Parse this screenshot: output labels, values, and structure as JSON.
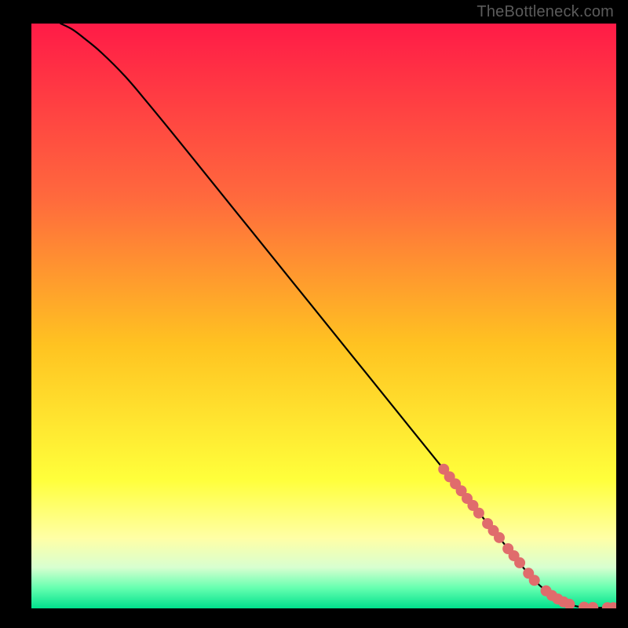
{
  "watermark": "TheBottleneck.com",
  "colors": {
    "frame": "#000000",
    "curve": "#000000",
    "marker_fill": "#e06c6c",
    "marker_stroke": "#c85a5a",
    "gradient_stops": [
      {
        "offset": 0.0,
        "color": "#ff1b47"
      },
      {
        "offset": 0.3,
        "color": "#ff6a3d"
      },
      {
        "offset": 0.55,
        "color": "#ffc321"
      },
      {
        "offset": 0.78,
        "color": "#ffff3b"
      },
      {
        "offset": 0.88,
        "color": "#ffffa6"
      },
      {
        "offset": 0.93,
        "color": "#d8ffd0"
      },
      {
        "offset": 0.965,
        "color": "#66ffb0"
      },
      {
        "offset": 1.0,
        "color": "#00e08c"
      }
    ]
  },
  "chart_data": {
    "type": "line",
    "title": "",
    "xlabel": "",
    "ylabel": "",
    "xlim": [
      0,
      100
    ],
    "ylim": [
      0,
      100
    ],
    "series": [
      {
        "name": "bottleneck-curve",
        "x": [
          5,
          7,
          9,
          12,
          16,
          20,
          25,
          30,
          35,
          40,
          45,
          50,
          55,
          60,
          65,
          70,
          73,
          76,
          79,
          82,
          84,
          86,
          88,
          90,
          92,
          94,
          96,
          98,
          100
        ],
        "y": [
          100,
          99,
          97.5,
          95,
          91,
          86.3,
          80.2,
          74.0,
          67.8,
          61.6,
          55.4,
          49.2,
          43.0,
          36.8,
          30.6,
          24.4,
          20.7,
          17.0,
          13.3,
          9.6,
          7.1,
          4.8,
          3.0,
          1.6,
          0.7,
          0.2,
          0.1,
          0.1,
          0.1
        ]
      }
    ],
    "markers": [
      {
        "x": 70.5,
        "y": 23.8
      },
      {
        "x": 71.5,
        "y": 22.5
      },
      {
        "x": 72.5,
        "y": 21.3
      },
      {
        "x": 73.5,
        "y": 20.1
      },
      {
        "x": 74.5,
        "y": 18.8
      },
      {
        "x": 75.5,
        "y": 17.6
      },
      {
        "x": 76.5,
        "y": 16.3
      },
      {
        "x": 78.0,
        "y": 14.5
      },
      {
        "x": 79.0,
        "y": 13.3
      },
      {
        "x": 80.0,
        "y": 12.1
      },
      {
        "x": 81.5,
        "y": 10.2
      },
      {
        "x": 82.5,
        "y": 9.0
      },
      {
        "x": 83.5,
        "y": 7.8
      },
      {
        "x": 85.0,
        "y": 6.0
      },
      {
        "x": 86.0,
        "y": 4.8
      },
      {
        "x": 88.0,
        "y": 3.0
      },
      {
        "x": 89.0,
        "y": 2.2
      },
      {
        "x": 90.0,
        "y": 1.6
      },
      {
        "x": 91.0,
        "y": 1.1
      },
      {
        "x": 92.0,
        "y": 0.7
      },
      {
        "x": 94.5,
        "y": 0.2
      },
      {
        "x": 96.0,
        "y": 0.15
      },
      {
        "x": 98.5,
        "y": 0.12
      },
      {
        "x": 99.5,
        "y": 0.12
      }
    ]
  }
}
